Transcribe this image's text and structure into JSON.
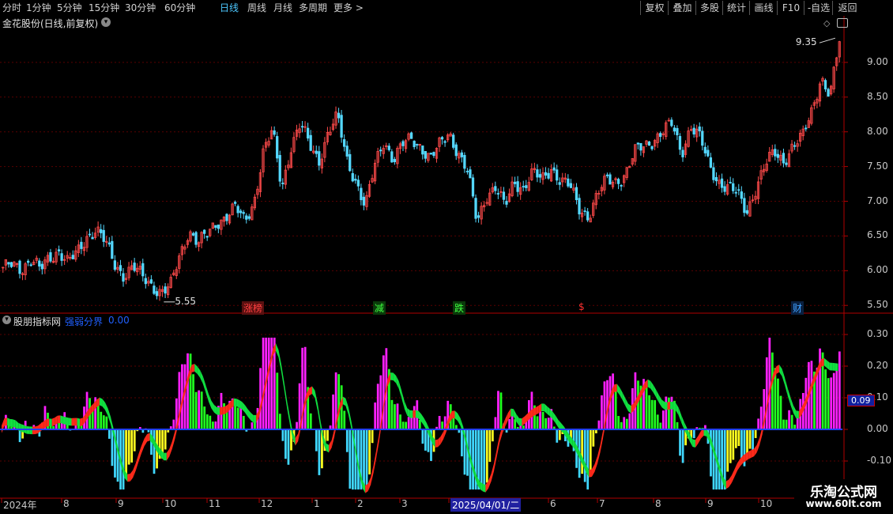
{
  "toolbar": {
    "periods": [
      "分时",
      "1分钟",
      "5分钟",
      "15分钟",
      "30分钟",
      "60分钟",
      "日线",
      "周线",
      "月线",
      "多周期",
      "更多 >"
    ],
    "active_period": "日线",
    "right_buttons": [
      "复权",
      "叠加",
      "多股",
      "统计",
      "画线",
      "F10",
      "-自选",
      "返回"
    ]
  },
  "main_panel": {
    "title": "金花股份(日线,前复权)",
    "price_axis": [
      "9.00",
      "8.50",
      "8.00",
      "7.50",
      "7.00",
      "6.50",
      "6.00",
      "5.50"
    ],
    "high_label": "9.35",
    "low_label": "5.55",
    "event_markers": [
      {
        "text": "涨榜",
        "color": "#ff4040",
        "bg": "#5a1010"
      },
      {
        "text": "减",
        "color": "#40ff40",
        "bg": "#0a3a0a"
      },
      {
        "text": "跌",
        "color": "#40ff40",
        "bg": "#0a3a0a"
      },
      {
        "text": "$",
        "color": "#ff3030",
        "bg": "#000000"
      },
      {
        "text": "财",
        "color": "#40a0ff",
        "bg": "#0a2040"
      }
    ]
  },
  "indicator_panel": {
    "title": "股朋指标网",
    "param_label": "强弱分界",
    "param_value": "0.00",
    "axis": [
      "0.30",
      "0.20",
      "0.10",
      "0.00",
      "-0.10"
    ],
    "current_value": "0.09"
  },
  "date_axis": [
    "2024年",
    "8",
    "9",
    "10",
    "11",
    "12",
    "1",
    "2",
    "3",
    "2025/04/01/二",
    "6",
    "7",
    "8",
    "9",
    "10"
  ],
  "watermark": {
    "title": "乐淘公式网",
    "url": "www.60lt.com"
  },
  "colors": {
    "up": "#ff4a4a",
    "down": "#54d8ff",
    "grid": "#5a0000",
    "bull_band": "#ff2a1a",
    "bear_band": "#10e040",
    "magenta": "#ff20ff",
    "green": "#20ff20",
    "cyan": "#40d8ff",
    "yellow": "#ffff20"
  },
  "chart_data": {
    "type": "candlestick",
    "price_ylim": [
      5.4,
      9.5
    ],
    "price_y_ticks": [
      5.5,
      6.0,
      6.5,
      7.0,
      7.5,
      8.0,
      8.5,
      9.0
    ],
    "marked_high": 9.35,
    "marked_low": 5.55,
    "close_path": [
      6.0,
      6.1,
      6.05,
      6.15,
      6.0,
      6.2,
      6.3,
      6.1,
      6.25,
      6.5,
      6.6,
      6.4,
      6.1,
      5.95,
      6.05,
      5.9,
      5.8,
      5.7,
      5.75,
      6.2,
      6.6,
      6.4,
      6.5,
      6.7,
      6.8,
      6.9,
      6.7,
      7.0,
      7.7,
      8.0,
      7.2,
      7.8,
      8.1,
      7.8,
      7.6,
      8.0,
      8.2,
      7.6,
      7.3,
      6.9,
      7.5,
      7.9,
      7.6,
      7.8,
      7.9,
      7.8,
      7.6,
      7.8,
      8.0,
      7.7,
      7.4,
      6.7,
      7.1,
      7.2,
      6.9,
      7.3,
      7.2,
      7.4,
      7.3,
      7.5,
      7.3,
      7.2,
      6.9,
      6.8,
      7.1,
      7.3,
      7.3,
      7.4,
      7.7,
      7.8,
      7.9,
      8.0,
      8.1,
      7.7,
      8.1,
      7.9,
      7.5,
      7.3,
      7.2,
      7.1,
      6.85,
      7.2,
      7.5,
      7.7,
      7.6,
      7.8,
      7.9,
      8.3,
      8.8,
      8.5,
      9.3
    ],
    "indicator_ylim": [
      -0.2,
      0.32
    ],
    "indicator_y_ticks": [
      -0.1,
      0.0,
      0.1,
      0.2,
      0.3
    ],
    "indicator_last": 0.09
  }
}
